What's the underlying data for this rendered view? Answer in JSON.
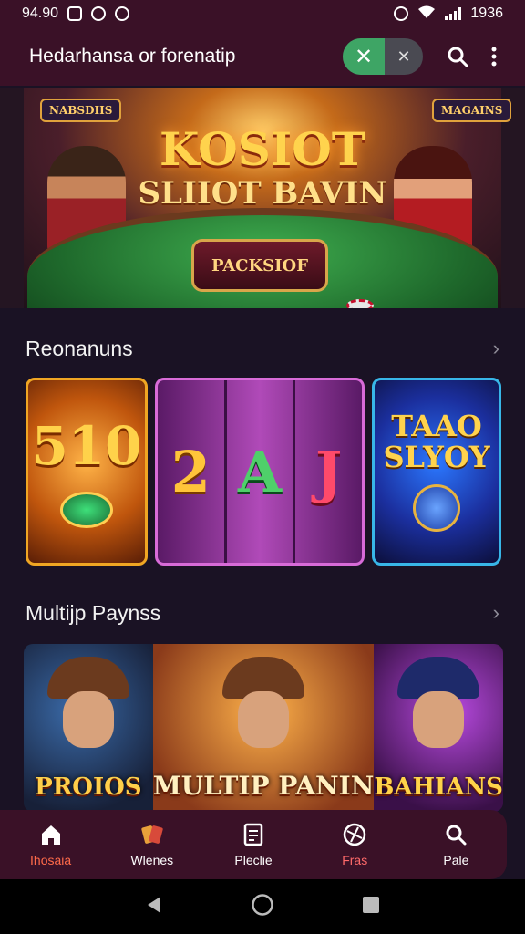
{
  "status_bar": {
    "time": "94.90",
    "right_text": "1936"
  },
  "app_bar": {
    "title": "Hedarhansa or forenatip",
    "toggle_on_icon": "✕",
    "toggle_off_icon": "✕"
  },
  "hero": {
    "title": "KOSIOT",
    "subtitle": "SLIIOT BAVIN",
    "plaque": "PACKSIOF",
    "sign_left": "NABSDIIS",
    "sign_right": "MAGAINS"
  },
  "recommendations": {
    "heading": "Reonanuns",
    "card1": {
      "text": "510"
    },
    "card2": {
      "reels": [
        "2",
        "A",
        "J"
      ]
    },
    "card3": {
      "line1": "TAAO",
      "line2": "SLYOY"
    }
  },
  "multiplayer": {
    "heading": "Multijp Paynss",
    "panels": [
      "PROIOS",
      "MULTIP PANIN",
      "BAHIANS"
    ]
  },
  "bottom_nav": {
    "items": [
      {
        "label": "Ihosaia",
        "icon": "home-icon"
      },
      {
        "label": "Wlenes",
        "icon": "cards-icon"
      },
      {
        "label": "Pleclie",
        "icon": "document-icon"
      },
      {
        "label": "Fras",
        "icon": "globe-icon"
      },
      {
        "label": "Pale",
        "icon": "search-icon"
      }
    ]
  },
  "colors": {
    "bar": "#3a1127",
    "accent_green": "#3ea565",
    "active": "#ff6a4a"
  }
}
